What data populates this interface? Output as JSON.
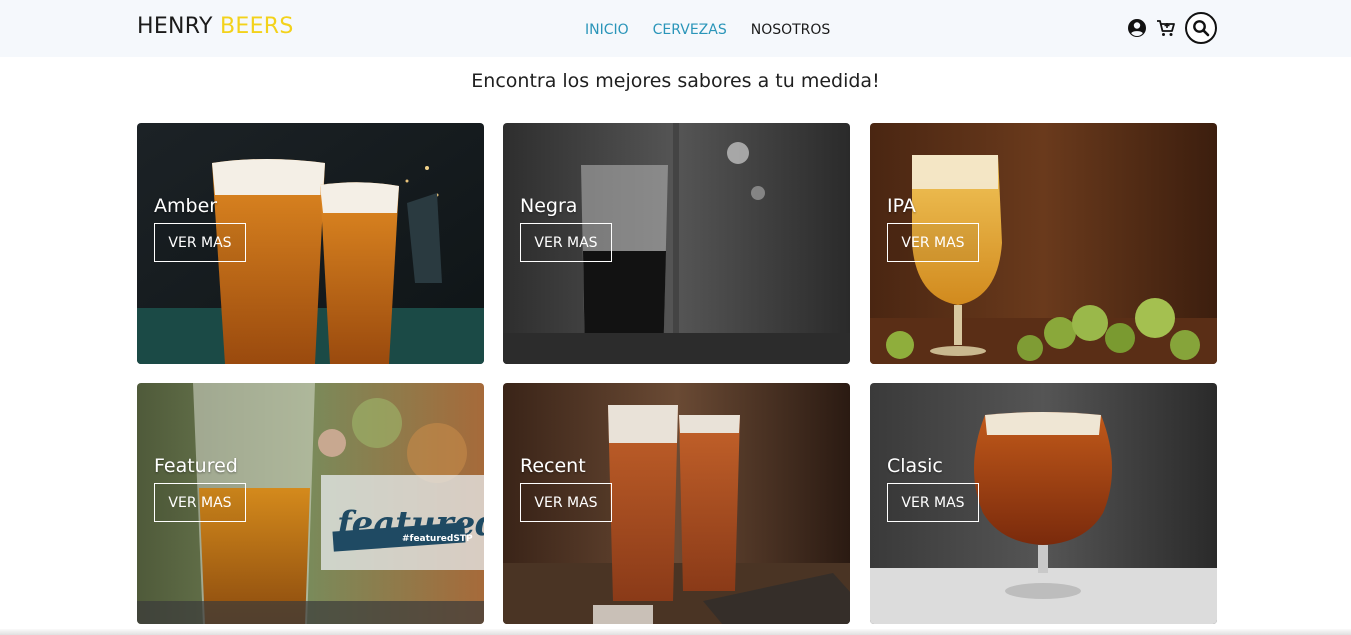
{
  "brand": {
    "part1": "HENRY",
    "part2": "BEERS"
  },
  "nav": {
    "inicio": "INICIO",
    "cervezas": "CERVEZAS",
    "nosotros": "NOSOTROS"
  },
  "icons": {
    "user": "user-circle-icon",
    "cart": "cart-icon",
    "search": "search-icon"
  },
  "colors": {
    "accent_yellow": "#f3d21b",
    "link_blue": "#2a95b9",
    "navbar_bg": "#f5f8fc"
  },
  "headline": "Encontra los mejores sabores a tu medida!",
  "cards": [
    {
      "title": "Amber",
      "button": "VER MAS"
    },
    {
      "title": "Negra",
      "button": "VER MAS"
    },
    {
      "title": "IPA",
      "button": "VER MAS"
    },
    {
      "title": "Featured",
      "button": "VER MAS"
    },
    {
      "title": "Recent",
      "button": "VER MAS"
    },
    {
      "title": "Clasic",
      "button": "VER MAS"
    }
  ],
  "featured_badge": {
    "word": "featured:",
    "tag": "#featuredSTP"
  }
}
